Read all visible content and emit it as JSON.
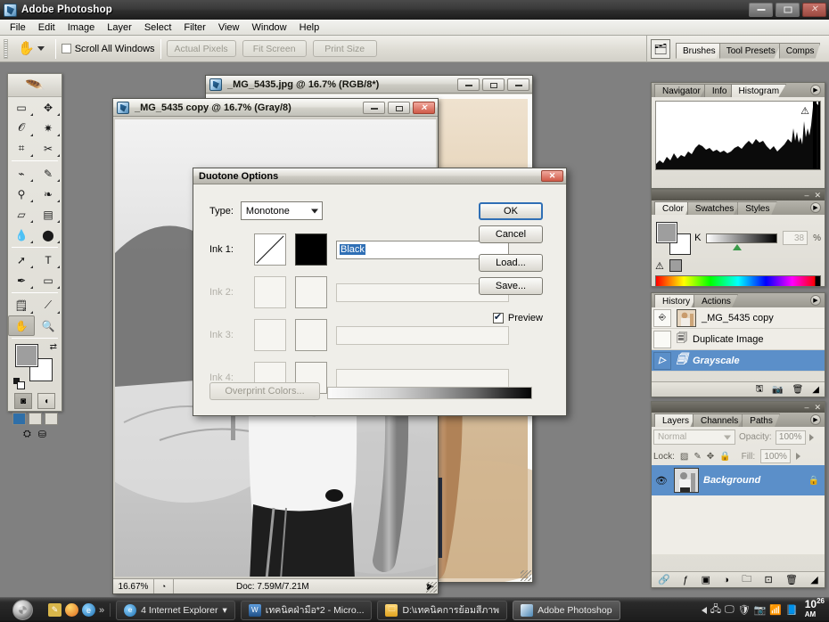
{
  "window": {
    "title": "Adobe Photoshop",
    "app_icon": "photoshop-icon",
    "minimize": "–",
    "maximize": "□",
    "close": "✕"
  },
  "menu": {
    "items": [
      "File",
      "Edit",
      "Image",
      "Layer",
      "Select",
      "Filter",
      "View",
      "Window",
      "Help"
    ]
  },
  "options_bar": {
    "tool_icon": "hand-tool-icon",
    "scroll_all_windows": "Scroll All Windows",
    "buttons": [
      "Actual Pixels",
      "Fit Screen",
      "Print Size"
    ],
    "palette_well_tabs": [
      "Brushes",
      "Tool Presets",
      "Comps"
    ],
    "palette_well_selected": "Brushes"
  },
  "toolbox": {
    "tools": [
      {
        "name": "rectangular-marquee-tool",
        "glyph": "▭"
      },
      {
        "name": "move-tool",
        "glyph": "➤"
      },
      {
        "name": "lasso-tool",
        "glyph": "𝒪"
      },
      {
        "name": "magic-wand-tool",
        "glyph": "✨"
      },
      {
        "name": "crop-tool",
        "glyph": "⌗"
      },
      {
        "name": "slice-tool",
        "glyph": "✂"
      },
      {
        "name": "healing-brush-tool",
        "glyph": "⌁"
      },
      {
        "name": "brush-tool",
        "glyph": "✎"
      },
      {
        "name": "clone-stamp-tool",
        "glyph": "⎙"
      },
      {
        "name": "history-brush-tool",
        "glyph": "❧"
      },
      {
        "name": "eraser-tool",
        "glyph": "▱"
      },
      {
        "name": "gradient-tool",
        "glyph": "▤"
      },
      {
        "name": "blur-tool",
        "glyph": "💧"
      },
      {
        "name": "dodge-tool",
        "glyph": "🜚"
      },
      {
        "name": "path-selection-tool",
        "glyph": "➚"
      },
      {
        "name": "type-tool",
        "glyph": "T"
      },
      {
        "name": "pen-tool",
        "glyph": "✒"
      },
      {
        "name": "rectangle-shape-tool",
        "glyph": "▬"
      },
      {
        "name": "notes-tool",
        "glyph": "🗒"
      },
      {
        "name": "eyedropper-tool",
        "glyph": "⟋"
      },
      {
        "name": "hand-tool",
        "glyph": "✋"
      },
      {
        "name": "zoom-tool",
        "glyph": "🔍"
      }
    ],
    "active_tool": "hand-tool",
    "foreground_color": "#9e9e9e",
    "background_color": "#ffffff",
    "quickmask_modes": [
      "standard-mode",
      "quick-mask-mode"
    ],
    "screen_modes": [
      "standard-screen-mode",
      "full-screen-with-menu",
      "full-screen"
    ]
  },
  "documents": [
    {
      "id": "rgb-doc",
      "title": "_MG_5435.jpg @ 16.7% (RGB/8*)",
      "active": false
    },
    {
      "id": "gray-doc",
      "title": "_MG_5435 copy @ 16.7% (Gray/8)",
      "active": true,
      "status": {
        "zoom": "16.67%",
        "doc_size": "Doc: 7.59M/7.21M",
        "arrow": "▶"
      }
    }
  ],
  "dialog": {
    "title": "Duotone Options",
    "close": "✕",
    "type_label": "Type:",
    "type_value": "Monotone",
    "inks": [
      {
        "label": "Ink 1:",
        "name": "Black",
        "color": "#000000",
        "enabled": true,
        "selected": true
      },
      {
        "label": "Ink 2:",
        "name": "",
        "color": "",
        "enabled": false,
        "selected": false
      },
      {
        "label": "Ink 3:",
        "name": "",
        "color": "",
        "enabled": false,
        "selected": false
      },
      {
        "label": "Ink 4:",
        "name": "",
        "color": "",
        "enabled": false,
        "selected": false
      }
    ],
    "buttons": {
      "ok": "OK",
      "cancel": "Cancel",
      "load": "Load...",
      "save": "Save...",
      "overprint": "Overprint Colors..."
    },
    "preview_label": "Preview",
    "preview_checked": true
  },
  "panels": {
    "histogram": {
      "tabs": [
        "Navigator",
        "Info",
        "Histogram"
      ],
      "selected": "Histogram",
      "warning_icon": "warning-triangle-icon"
    },
    "color": {
      "tabs": [
        "Color",
        "Swatches",
        "Styles"
      ],
      "selected": "Color",
      "channel_label": "K",
      "channel_value": "38",
      "percent": "%",
      "out_of_gamut_icon": "warning-triangle-icon"
    },
    "history": {
      "tabs": [
        "History",
        "Actions"
      ],
      "selected": "History",
      "items": [
        {
          "label": "_MG_5435 copy",
          "type": "snapshot",
          "selected": false
        },
        {
          "label": "Duplicate Image",
          "type": "state",
          "selected": false
        },
        {
          "label": "Grayscale",
          "type": "state",
          "selected": true
        }
      ],
      "footer_icons": [
        "new-document-icon",
        "new-snapshot-icon",
        "delete-icon"
      ]
    },
    "layers": {
      "tabs": [
        "Layers",
        "Channels",
        "Paths"
      ],
      "selected": "Layers",
      "blend_mode": "Normal",
      "opacity_label": "Opacity:",
      "opacity_value": "100%",
      "lock_label": "Lock:",
      "fill_label": "Fill:",
      "fill_value": "100%",
      "lock_icons": [
        "lock-transparent-icon",
        "lock-image-icon",
        "lock-position-icon",
        "lock-all-icon"
      ],
      "rows": [
        {
          "name": "Background",
          "locked": true,
          "visible": true,
          "selected": true
        }
      ],
      "footer_icons": [
        "link-layers-icon",
        "layer-style-icon",
        "layer-mask-icon",
        "adjustment-layer-icon",
        "new-group-icon",
        "new-layer-icon",
        "delete-layer-icon"
      ]
    }
  },
  "taskbar": {
    "start_label": "start",
    "quick_launch": [
      "notes-icon",
      "browser-orb-icon",
      "internet-explorer-icon",
      "chevron-more-icon"
    ],
    "buttons": [
      {
        "label": "4 Internet Explorer",
        "icon": "internet-explorer-icon",
        "active": false,
        "group": true
      },
      {
        "label": "เทคนิคฝ่ามือ*2 - Micro...",
        "icon": "word-icon",
        "active": false
      },
      {
        "label": "D:\\เทคนิคการย้อมสีภาพ",
        "icon": "folder-icon",
        "active": false
      },
      {
        "label": "Adobe Photoshop",
        "icon": "photoshop-icon",
        "active": true
      }
    ],
    "tray_icons": [
      "chevron-left-icon",
      "network-icon",
      "display-icon",
      "antivirus-icon",
      "camera-icon",
      "equalizer-icon",
      "book-icon"
    ],
    "clock_hour": "10",
    "clock_min": "26",
    "clock_ampm": "AM"
  },
  "colors": {
    "accent": "#2f6fb5",
    "selection": "#5b8fc9",
    "canvas_bg": "#808080",
    "panel_bg": "#eceae4",
    "ink1": "#000000"
  }
}
